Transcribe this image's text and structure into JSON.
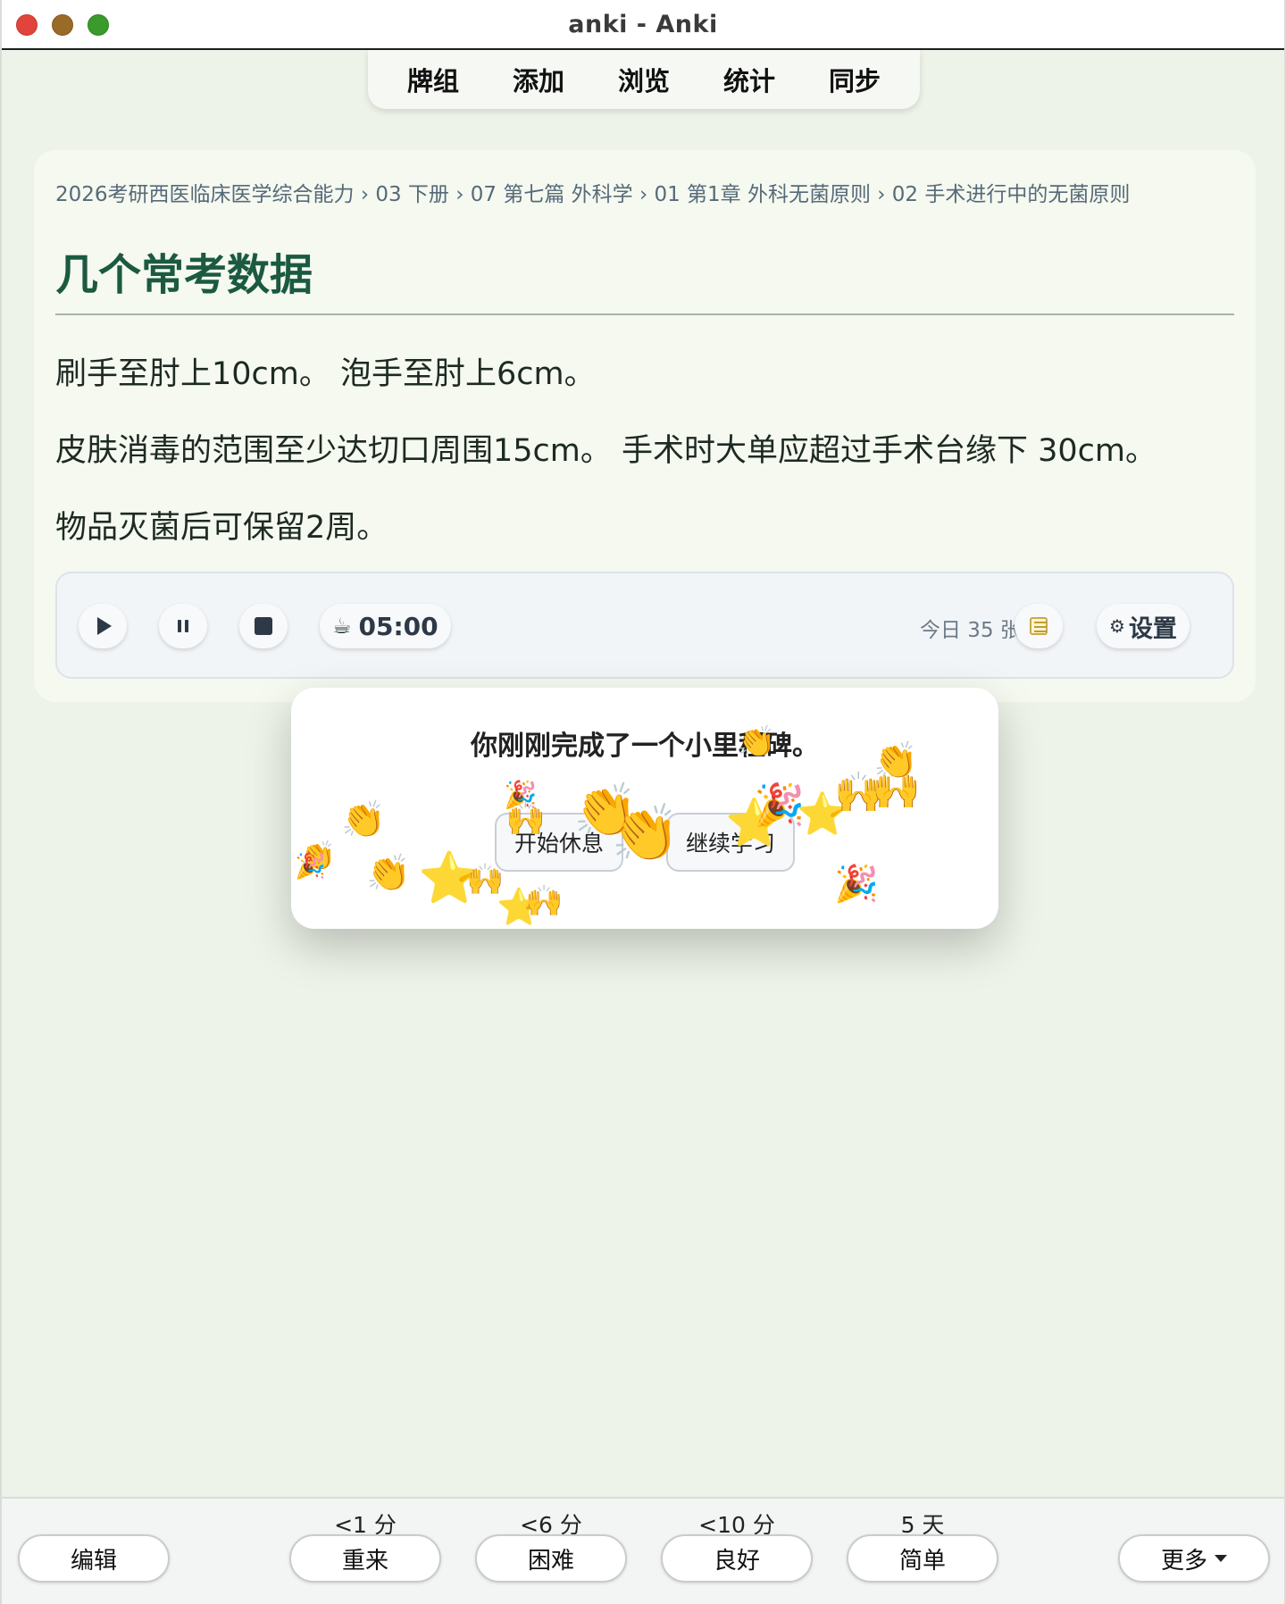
{
  "window": {
    "title": "anki - Anki"
  },
  "nav": {
    "items": [
      "牌组",
      "添加",
      "浏览",
      "统计",
      "同步"
    ]
  },
  "card": {
    "breadcrumb": "2026考研西医临床医学综合能力 › 03 下册 › 07 第七篇 外科学 › 01 第1章 外科无菌原则 › 02 手术进行中的无菌原则",
    "title": "几个常考数据",
    "paragraphs": [
      "刷手至肘上10cm。 泡手至肘上6cm。",
      "皮肤消毒的范围至少达切口周围15cm。 手术时大单应超过手术台缘下 30cm。",
      "物品灭菌后可保留2周。"
    ]
  },
  "toolbar": {
    "timer_icon": "☕",
    "timer": "05:00",
    "today": "今日 35 张",
    "settings_icon": "⚙",
    "settings_label": "设置"
  },
  "popup": {
    "message": "你刚刚完成了一个小里程碑。",
    "rest_label": "开始休息",
    "continue_label": "继续学习"
  },
  "bottom": {
    "edit_label": "编辑",
    "more_label": "更多",
    "answers": [
      {
        "interval": "<1 分",
        "label": "重来"
      },
      {
        "interval": "<6 分",
        "label": "困难"
      },
      {
        "interval": "<10 分",
        "label": "良好"
      },
      {
        "interval": "5 天",
        "label": "简单"
      }
    ]
  }
}
